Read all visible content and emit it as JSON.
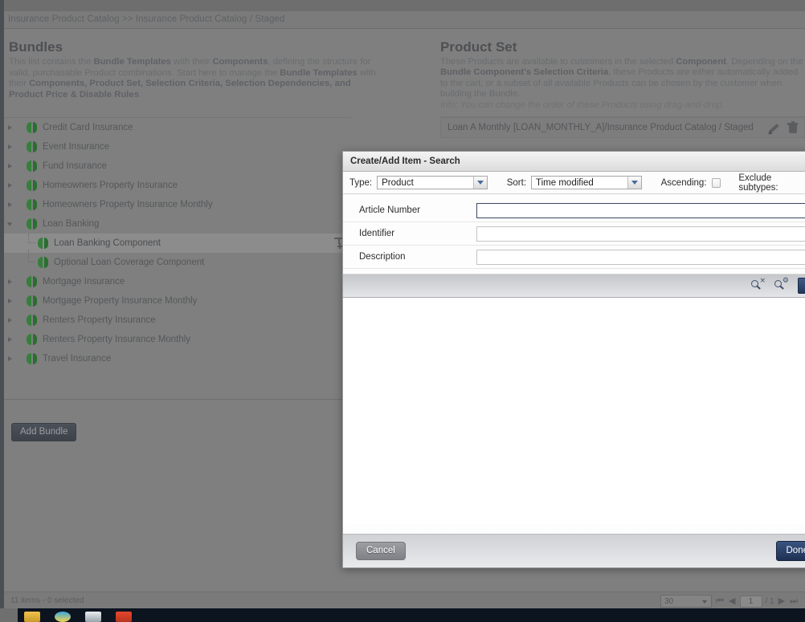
{
  "breadcrumb": "Insurance Product Catalog >> Insurance Product Catalog / Staged",
  "bundles": {
    "title": "Bundles",
    "desc_1": "This list contains the ",
    "desc_b1": "Bundle Templates",
    "desc_2": " with their ",
    "desc_b2": "Components",
    "desc_3": ", defining the structure for valid, purchasable Product combinations. Start here to manage the ",
    "desc_b3": "Bundle Templates",
    "desc_4": " with their ",
    "desc_b4": "Components, Product Set, Selection Criteria, Selection Dependencies, and Product Price & Disable Rules",
    "desc_5": ".",
    "add_button": "Add Bundle",
    "items": [
      {
        "label": "Credit Card Insurance",
        "level": 0,
        "expanded": false,
        "selected": false
      },
      {
        "label": "Event Insurance",
        "level": 0,
        "expanded": false,
        "selected": false
      },
      {
        "label": "Fund Insurance",
        "level": 0,
        "expanded": false,
        "selected": false
      },
      {
        "label": "Homeowners Property Insurance",
        "level": 0,
        "expanded": false,
        "selected": false
      },
      {
        "label": "Homeowners Property Insurance Monthly",
        "level": 0,
        "expanded": false,
        "selected": false
      },
      {
        "label": "Loan Banking",
        "level": 0,
        "expanded": true,
        "selected": false
      },
      {
        "label": "Loan Banking Component",
        "level": 1,
        "expanded": false,
        "selected": true
      },
      {
        "label": "Optional Loan Coverage Component",
        "level": 1,
        "expanded": false,
        "selected": false,
        "last_child": true
      },
      {
        "label": "Mortgage Insurance",
        "level": 0,
        "expanded": false,
        "selected": false
      },
      {
        "label": "Mortgage Property Insurance Monthly",
        "level": 0,
        "expanded": false,
        "selected": false
      },
      {
        "label": "Renters Property Insurance",
        "level": 0,
        "expanded": false,
        "selected": false
      },
      {
        "label": "Renters Property Insurance Monthly",
        "level": 0,
        "expanded": false,
        "selected": false
      },
      {
        "label": "Travel Insurance",
        "level": 0,
        "expanded": false,
        "selected": false
      }
    ]
  },
  "product_set": {
    "title": "Product Set",
    "desc_1": "These Products are available to customers in the selected ",
    "desc_b1": "Component",
    "desc_2": ". Depending on the ",
    "desc_b2": "Bundle Component's Selection Criteria",
    "desc_3": ", these Products are either automatically added to the cart, or a subset of all available Products can be chosen by the customer when building the Bundle.",
    "info": "Info: You can change the order of these Products using drag-and-drop.",
    "rows": [
      {
        "label": "Loan A Monthly [LOAN_MONTHLY_A]/Insurance Product Catalog / Staged"
      }
    ]
  },
  "status": {
    "text": "11 items - 0 selected",
    "page_size": "30",
    "page_current": "1",
    "page_total": "/ 1"
  },
  "dialog": {
    "title": "Create/Add Item - Search",
    "type_label": "Type:",
    "type_value": "Product",
    "sort_label": "Sort:",
    "sort_value": "Time modified",
    "ascending_label": "Ascending:",
    "exclude_subtypes_label": "Exclude subtypes:",
    "fields": [
      {
        "label": "Article Number",
        "value": "",
        "focused": true
      },
      {
        "label": "Identifier",
        "value": "",
        "focused": false
      },
      {
        "label": "Description",
        "value": "",
        "focused": false
      }
    ],
    "clear_search_badge": "×",
    "advanced_search_badge": "⚙",
    "search_button_label": "",
    "cancel_label": "Cancel",
    "done_label": "Done"
  },
  "colors": {
    "bundle_icon_green": "#2f7a36",
    "done_button": "#22365a",
    "dropdown_arrow": "#4a6b9c"
  }
}
